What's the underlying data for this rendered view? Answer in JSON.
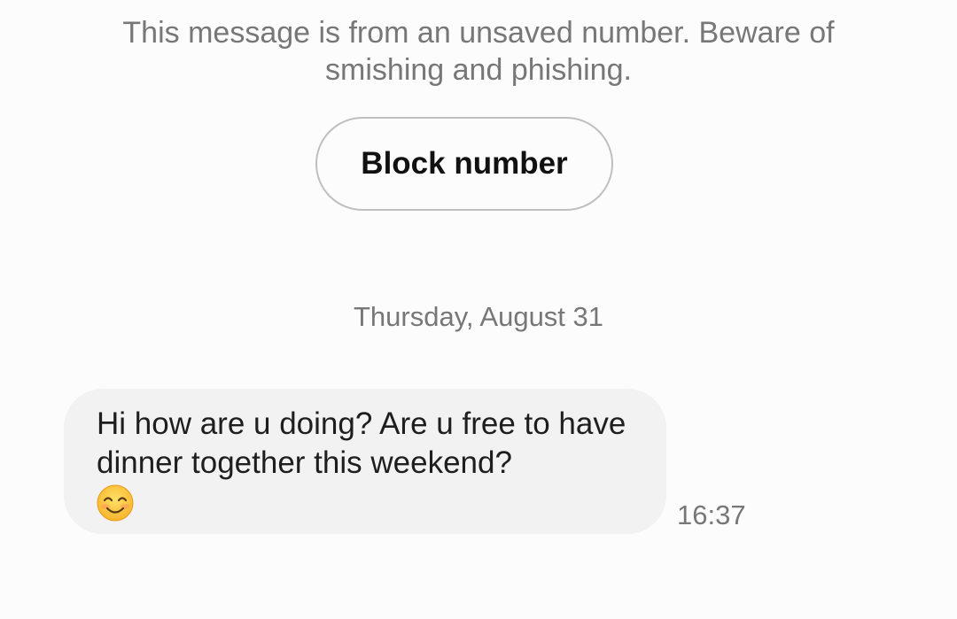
{
  "warning": {
    "text": "This message is from an unsaved number. Beware of smishing and phishing."
  },
  "actions": {
    "block_label": "Block number"
  },
  "conversation": {
    "date_separator": "Thursday, August 31",
    "messages": [
      {
        "text": "Hi how are u doing? Are u free to have dinner together this weekend?",
        "emoji": "smiling-face-icon",
        "time": "16:37"
      }
    ]
  },
  "colors": {
    "background": "#fcfcfc",
    "bubble": "#f2f2f2",
    "secondary_text": "#777777",
    "primary_text": "#1e1e1e",
    "button_border": "#bfbfbf"
  }
}
